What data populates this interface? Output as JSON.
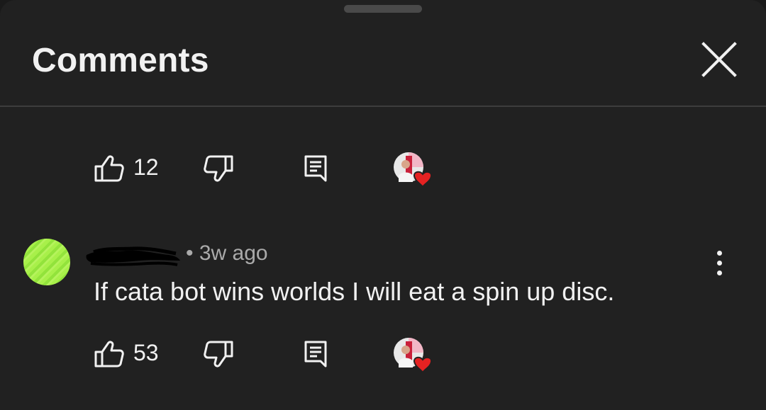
{
  "header": {
    "title": "Comments",
    "close_icon": "close-icon"
  },
  "replies": [
    {
      "like_count": "12",
      "icons": [
        "thumbs-up-icon",
        "thumbs-down-icon",
        "reply-icon",
        "creator-heart-icon"
      ]
    },
    {
      "like_count": "53",
      "icons": [
        "thumbs-up-icon",
        "thumbs-down-icon",
        "reply-icon",
        "creator-heart-icon"
      ]
    }
  ],
  "comment": {
    "meta": "• 3w ago",
    "text": "If cata bot wins worlds I will eat a spin up disc.",
    "menu_icon": "more-vert-icon"
  },
  "colors": {
    "background": "#212121",
    "text": "#f1f1f1",
    "secondary_text": "#aaaaaa",
    "heart": "#e52222",
    "avatar": "#a8f04a"
  }
}
